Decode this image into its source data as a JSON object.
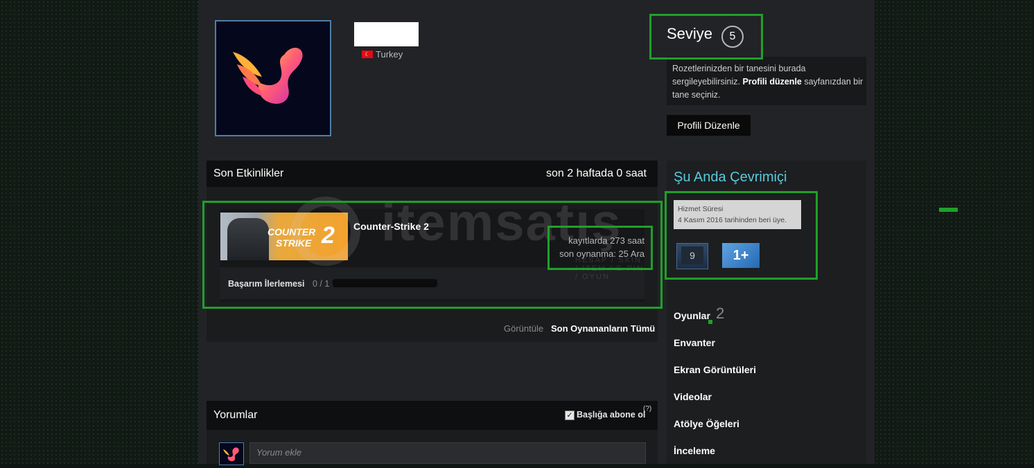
{
  "profile": {
    "country": "Turkey",
    "level_label": "Seviye",
    "level_value": "5",
    "badge_note_pre": "Rozetlerinizden bir tanesini burada sergileyebilirsiniz.",
    "badge_note_link": "Profili düzenle",
    "badge_note_post": "sayfanızdan bir tane seçiniz.",
    "edit_button": "Profili Düzenle"
  },
  "activity": {
    "title": "Son Etkinlikler",
    "hours_summary": "son 2 haftada 0 saat",
    "game": {
      "capsule_line1": "COUNTER",
      "capsule_line2": "STRIKE",
      "capsule_number": "2",
      "name": "Counter-Strike 2",
      "hours_on_record": "kayıtlarda 273 saat",
      "last_played": "son oynanma: 25 Ara",
      "achievement_label": "Başarım İlerlemesi",
      "achievement_count": "0 / 1",
      "achievement_progress": 0
    },
    "view_label": "Görüntüle",
    "view_link": "Son Oynananların Tümü"
  },
  "comments": {
    "title": "Yorumlar",
    "subscribe_label": "Başlığa abone ol",
    "subscribe_checked": true,
    "help": "(?)",
    "placeholder": "Yorum ekle"
  },
  "sidebar": {
    "online_status": "Şu Anda Çevrimiçi",
    "service_title": "Hizmet Süresi",
    "service_text": "4 Kasım 2016 tarihinden beri üye.",
    "badge1_value": "9",
    "badge2_value": "1+",
    "nav": [
      {
        "label": "Oyunlar",
        "count": "2"
      },
      {
        "label": "Envanter"
      },
      {
        "label": "Ekran Görüntüleri"
      },
      {
        "label": "Videolar"
      },
      {
        "label": "Atölye Öğeleri"
      },
      {
        "label": "İnceleme"
      }
    ]
  },
  "watermark": {
    "text": "itemsatış",
    "subtext": "HESAP / SKIN / ITEM / E-PIN / OYUN"
  },
  "colors": {
    "highlight": "#1fa02a",
    "online": "#57cbde",
    "panel": "#222326"
  }
}
